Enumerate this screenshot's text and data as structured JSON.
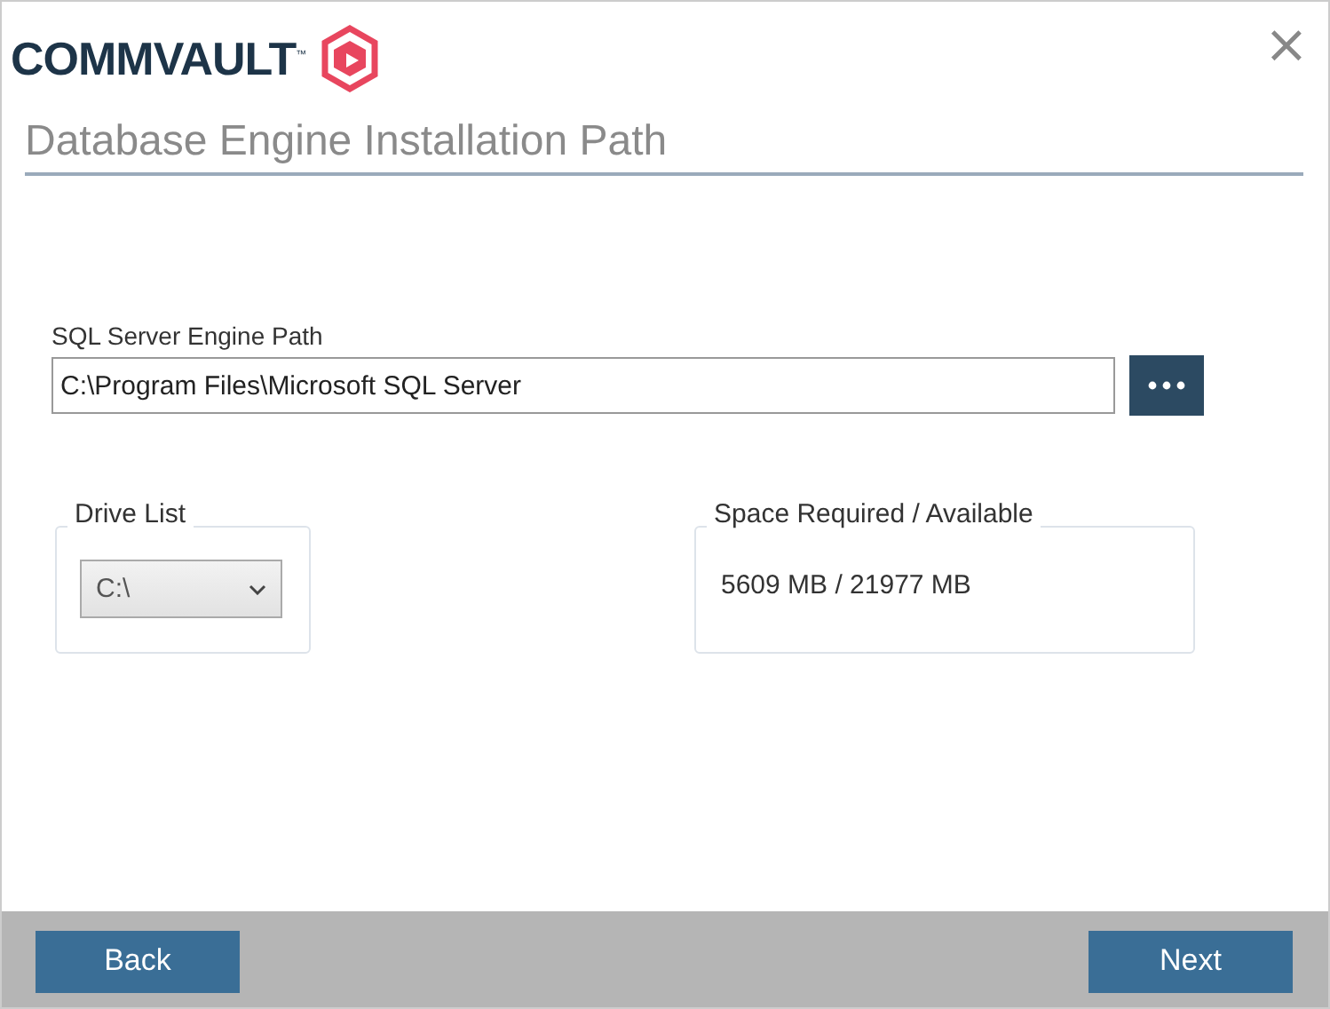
{
  "logo": {
    "text": "COMMVAULT$^{™}$"
  },
  "close": {
    "glyph": "×"
  },
  "heading": "Database Engine Installation Path",
  "engine_path": {
    "label": "SQL Server Engine Path",
    "value": "C:\\Program Files\\Microsoft SQL Server"
  },
  "drive_list": {
    "legend": "Drive List",
    "value": "C:\\"
  },
  "space": {
    "legend": "Space Required / Available",
    "value": "5609 MB / 21977 MB"
  },
  "buttons": [
    {
      "label": "Back",
      "kind": "back"
    },
    {
      "label": "Next",
      "kind": "next"
    }
  ]
}
